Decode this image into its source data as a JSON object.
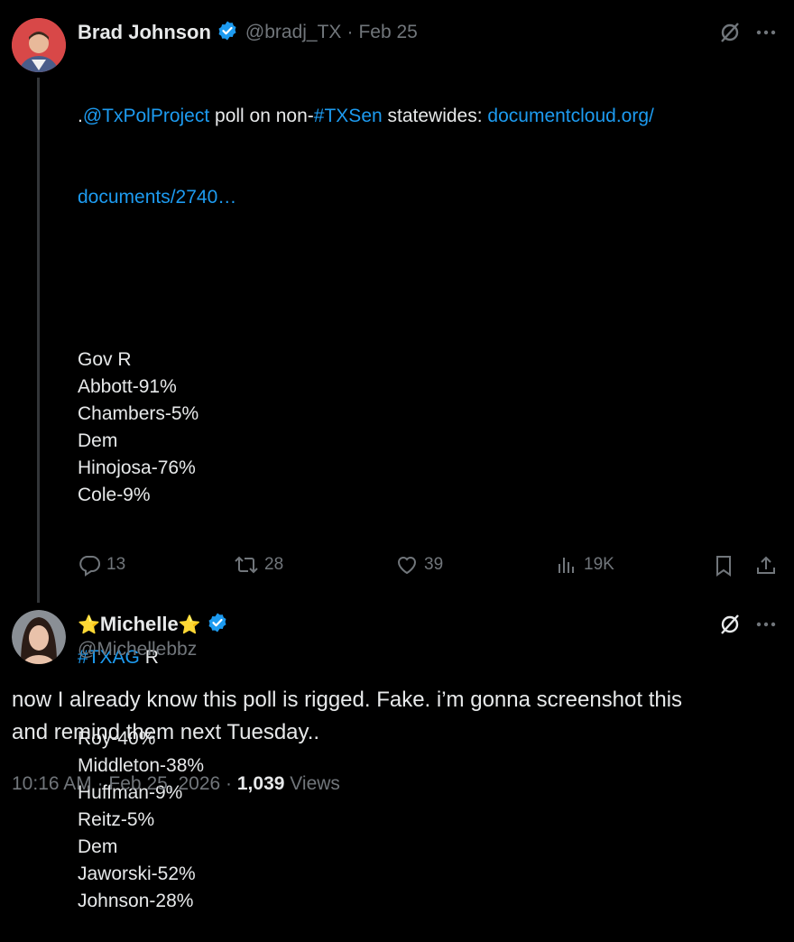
{
  "tweet1": {
    "name": "Brad Johnson",
    "handle": "@bradj_TX",
    "separator": "·",
    "date": "Feb 25",
    "text_prefix": ".",
    "mention": "@TxPolProject",
    "text_mid1": " poll on non-",
    "hashtag1": "#TXSen",
    "text_mid2": " statewides: ",
    "link_line1": "documentcloud.org/",
    "link_line2": "documents/2740…",
    "lines_a": [
      "Gov R",
      "Abbott-91%",
      "Chambers-5%",
      "Dem",
      "Hinojosa-76%",
      "Cole-9%"
    ],
    "hashtag2": "#TXAG",
    "hashtag2_suffix": " R",
    "lines_b": [
      "Roy-40%",
      "Middleton-38%",
      "Huffman-9%",
      "Reitz-5%",
      "Dem",
      "Jaworski-52%",
      "Johnson-28%"
    ],
    "stats": {
      "replies": "13",
      "reposts": "28",
      "likes": "39",
      "views": "19K"
    }
  },
  "tweet2": {
    "name_star_left": "⭐",
    "name": "Michelle",
    "name_star_right": "⭐",
    "handle": "@Michellebbz",
    "text_line1": "now I already know this poll is rigged. Fake. i’m gonna screenshot this",
    "text_line2": "and remind them next Tuesday..",
    "time": "10:16 AM",
    "dot1": "·",
    "date": "Feb 25, 2026",
    "dot2": "·",
    "views_count": "1,039",
    "views_label": "Views"
  },
  "colors": {
    "background": "#000000",
    "text": "#e7e9ea",
    "muted": "#71767b",
    "link": "#1d9bf0",
    "verified": "#1d9bf0"
  },
  "icons": [
    "grok-icon",
    "more-icon",
    "reply-icon",
    "repost-icon",
    "like-icon",
    "views-icon",
    "bookmark-icon",
    "share-icon",
    "verified-badge-icon"
  ]
}
